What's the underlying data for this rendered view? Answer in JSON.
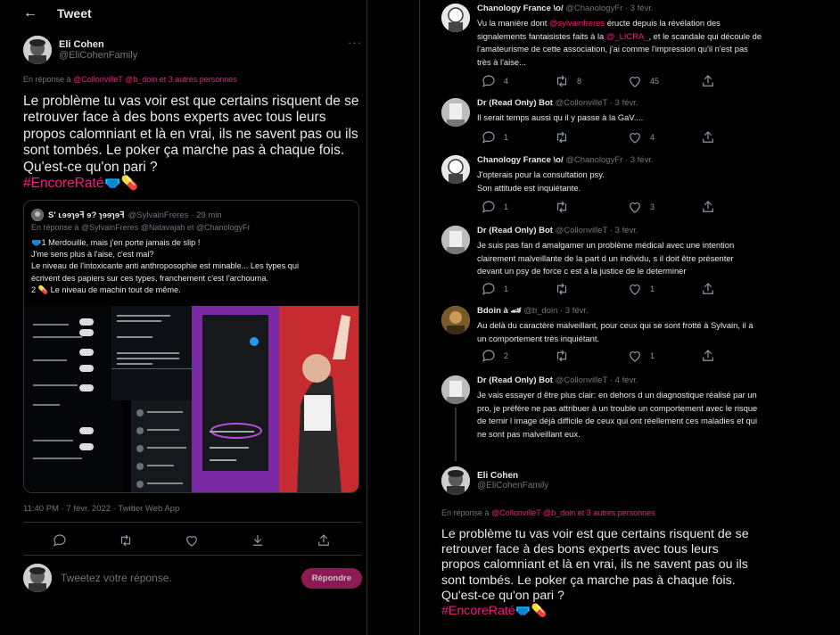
{
  "left": {
    "header_title": "Tweet",
    "author": {
      "display_name": "Eli Cohen",
      "handle": "@EliCohenFamily"
    },
    "replying_prefix": "En réponse à",
    "replying_handles": "@CollonvilleT @b_doin",
    "replying_suffix": "et 3 autres personnes",
    "text_lines": [
      "Le problème tu vas voir est que certains risquent de se",
      "retrouver face à des bons experts avec tous leurs",
      "propos calomniant et là en vrai, ils ne savent pas ou ils",
      "sont tombés. Le poker ça marche pas à chaque fois.",
      "Qu'est-ce qu'on pari ?"
    ],
    "hashtag": "#EncoreRaté",
    "quote": {
      "display_name": "S' ʟɘɘɿɘꟻ ɘ? ɿɘɘɿɘꟻ",
      "handle": "@SylvainFreres",
      "time": "· 29 min",
      "replying": "En réponse à @SylvainFreres @Natavajah  et  @ChanologyFr",
      "lines": [
        "🩲1 Merdouille, mais j'en porte jamais de slip !",
        "J'me sens plus à l'aise, c'est mal?",
        "Le niveau de l'intoxicante anti anthroposophie est minable... Les types qui",
        "écrivent des papiers sur ces types, franchement c'est l'archouma.",
        "2 💊 Le niveau de machin tout de même."
      ]
    },
    "meta": "11:40 PM · 7 févr. 2022 · Twitter Web App",
    "reply_placeholder": "Tweetez votre réponse.",
    "reply_button": "Répondre"
  },
  "right": {
    "tweets": [
      {
        "display_name": "Chanology France \\o/",
        "handle": "@ChanologyFr",
        "time": "· 3 févr.",
        "lines": [
          "Vu la manière dont @sylvainfreres éructe depuis la révélation des",
          "signalements fantaisistes faits à la @_LICRA_, et le scandale qui découle de",
          "l'amateurisme de cette association, j'ai comme l'impression qu'il n'est pas",
          "très à l'aise..."
        ],
        "replies": "4",
        "retweets": "8",
        "likes": "45"
      },
      {
        "display_name": "Dr (Read Only) Bot",
        "handle": "@CollonvilleT",
        "time": "· 3 févr.",
        "lines": [
          "Il serait temps aussi qu il y passe à la GaV...."
        ],
        "replies": "1",
        "retweets": "",
        "likes": "4"
      },
      {
        "display_name": "Chanology France \\o/",
        "handle": "@ChanologyFr",
        "time": "· 3 févr.",
        "lines": [
          "J'opterais pour la consultation psy.",
          "Son attitude est inquiétante."
        ],
        "replies": "1",
        "retweets": "",
        "likes": "3"
      },
      {
        "display_name": "Dr (Read Only) Bot",
        "handle": "@CollonvilleT",
        "time": "· 3 févr.",
        "lines": [
          "Je suis pas fan d amalgamer un problème médical avec une intention",
          "clairement malveillante de la part d un individu, s il doit être présenter",
          "devant un psy de force c est à la justice de le determiner"
        ],
        "replies": "1",
        "retweets": "",
        "likes": "1"
      },
      {
        "display_name": "Bdoin à 🏎",
        "handle": "@b_doin",
        "time": "· 3 févr.",
        "lines": [
          "Au delà du caractère malveillant, pour ceux qui se sont frotté à Sylvain, il a",
          "un comportement très inquiétant."
        ],
        "replies": "2",
        "retweets": "",
        "likes": "1"
      },
      {
        "display_name": "Dr (Read Only) Bot",
        "handle": "@CollonvilleT",
        "time": "· 4 févr.",
        "lines": [
          "Je vais essayer d être plus clair: en dehors d un diagnostique réalisé par un",
          "pro, je préfère ne pas attribuer à un trouble un comportement avec le risque",
          "de ternir l image déjà difficile de ceux qui ont réellement ces maladies et qui",
          "ne sont pas malveillant eux."
        ],
        "replies": "",
        "retweets": "",
        "likes": ""
      }
    ],
    "main": {
      "display_name": "Eli Cohen",
      "handle": "@EliCohenFamily",
      "replying_prefix": "En réponse à",
      "replying_handles": "@CollonvilleT @b_doin",
      "replying_suffix": "et 3 autres personnes",
      "text_lines": [
        "Le problème tu vas voir est que certains risquent de se",
        "retrouver face à des bons experts avec tous leurs",
        "propos calomniant et là en vrai, ils ne savent pas ou ils",
        "sont tombés. Le poker ça marche pas à chaque fois.",
        "Qu'est-ce qu'on pari ?"
      ],
      "hashtag": "#EncoreRaté"
    }
  },
  "colors": {
    "accent": "#f91880",
    "background": "#000000",
    "muted": "#71767b",
    "border": "#2f3336"
  },
  "icons": [
    "back-arrow-icon",
    "more-icon",
    "reply-icon",
    "retweet-icon",
    "like-icon",
    "share-icon",
    "bookmark-icon"
  ]
}
